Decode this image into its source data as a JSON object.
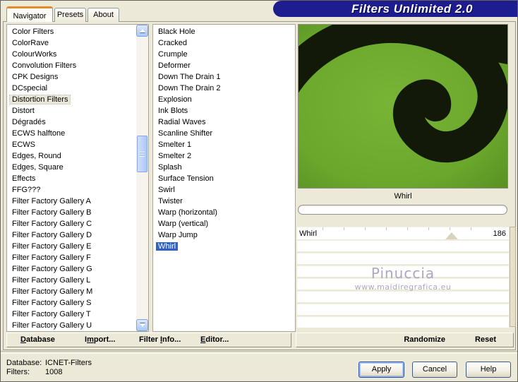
{
  "window": {
    "title": "Filters Unlimited 2.0"
  },
  "tabs": {
    "items": [
      {
        "label": "Navigator",
        "active": true
      },
      {
        "label": "Presets",
        "active": false
      },
      {
        "label": "About",
        "active": false
      }
    ]
  },
  "category_list": {
    "selected": "Distortion Filters",
    "items": [
      "Color Filters",
      "ColorRave",
      "ColourWorks",
      "Convolution Filters",
      "CPK Designs",
      "DCspecial",
      "Distortion Filters",
      "Distort",
      "Dégradés",
      "ECWS halftone",
      "ECWS",
      "Edges, Round",
      "Edges, Square",
      "Effects",
      "FFG???",
      "Filter Factory Gallery A",
      "Filter Factory Gallery B",
      "Filter Factory Gallery C",
      "Filter Factory Gallery D",
      "Filter Factory Gallery E",
      "Filter Factory Gallery F",
      "Filter Factory Gallery G",
      "Filter Factory Gallery L",
      "Filter Factory Gallery M",
      "Filter Factory Gallery S",
      "Filter Factory Gallery T",
      "Filter Factory Gallery U"
    ]
  },
  "filter_list": {
    "selected": "Whirl",
    "items": [
      "Black Hole",
      "Cracked",
      "Crumple",
      "Deformer",
      "Down The Drain 1",
      "Down The Drain 2",
      "Explosion",
      "Ink Blots",
      "Radial Waves",
      "Scanline Shifter",
      "Smelter 1",
      "Smelter 2",
      "Splash",
      "Surface Tension",
      "Swirl",
      "Twister",
      "Warp (horizontal)",
      "Warp (vertical)",
      "Warp Jump",
      "Whirl"
    ]
  },
  "preview": {
    "caption": "Whirl"
  },
  "watermark": {
    "name": "Pinuccia",
    "url": "www.maidiregrafica.eu"
  },
  "slider": {
    "label": "Whirl",
    "value": "186"
  },
  "toolbar": {
    "database": {
      "pre": "",
      "key": "D",
      "post": "atabase"
    },
    "import": {
      "pre": "I",
      "key": "m",
      "post": "port..."
    },
    "filter_info": {
      "pre": "Filter ",
      "key": "I",
      "post": "nfo..."
    },
    "editor": {
      "pre": "",
      "key": "E",
      "post": "ditor..."
    },
    "randomize": "Randomize",
    "reset": "Reset"
  },
  "status": {
    "database_label": "Database:",
    "database_value": "ICNET-Filters",
    "filters_label": "Filters:",
    "filters_value": "1008"
  },
  "dialog_buttons": {
    "apply": "Apply",
    "cancel": "Cancel",
    "help": "Help"
  },
  "colors": {
    "dialog_bg": "#ece9d8",
    "banner": "#1d1d8f",
    "tab_accent": "#e68b2c",
    "selection_blue": "#2f62c4",
    "inactive_selection": "#ebe7d6",
    "preview_green": "#6fae2e",
    "preview_dark": "#131908",
    "watermark": "#a49dbb"
  }
}
